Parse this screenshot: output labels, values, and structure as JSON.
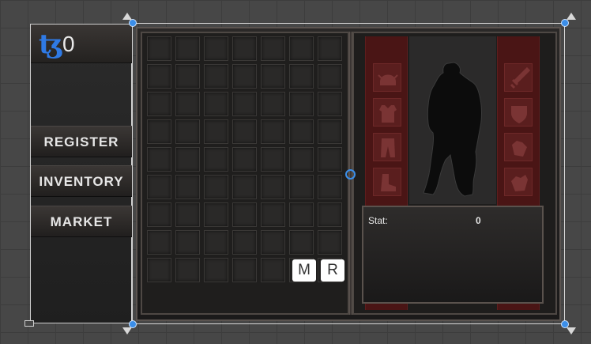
{
  "currency": {
    "icon": "tezos-coin-icon",
    "count": "0"
  },
  "menu": {
    "register": "REGISTER",
    "inventory": "INVENTORY",
    "market": "MARKET"
  },
  "inventory": {
    "rows": 9,
    "cols": 7
  },
  "sort_buttons": {
    "m": "M",
    "r": "R"
  },
  "equipment": {
    "left_slots": [
      "helmet-icon",
      "armor-icon",
      "pants-icon",
      "boots-icon"
    ],
    "right_slots": [
      "sword-icon",
      "shield-icon",
      "gauntlet-icon",
      "gloves-icon"
    ]
  },
  "stats": {
    "label": "Stat:",
    "value": "0"
  },
  "colors": {
    "equip_red": "#4a1515",
    "selection_blue": "#3b8ee8",
    "coin_blue": "#2f7ae5"
  }
}
